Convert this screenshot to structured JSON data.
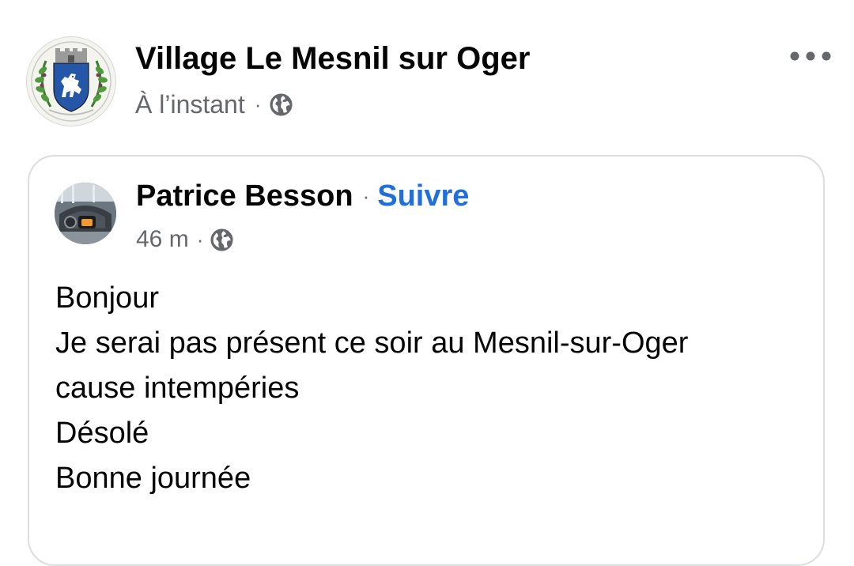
{
  "post": {
    "page_name": "Village Le Mesnil sur Oger",
    "timestamp": "À l’instant",
    "separator": "·",
    "audience_icon": "globe-icon",
    "more_icon": "more-options-icon"
  },
  "shared_post": {
    "author_name": "Patrice Besson",
    "separator": "·",
    "follow_label": "Suivre",
    "timestamp": "46 m",
    "audience_icon": "globe-icon",
    "lines": [
      "Bonjour",
      "Je serai pas présent ce soir au Mesnil-sur-Oger",
      "cause intempéries",
      "Désolé",
      "Bonne journée"
    ]
  },
  "colors": {
    "primary_text": "#050505",
    "secondary_text": "#65676b",
    "link_blue": "#216fdb",
    "card_border": "#dadde1",
    "crest_blue": "#2557a8"
  }
}
